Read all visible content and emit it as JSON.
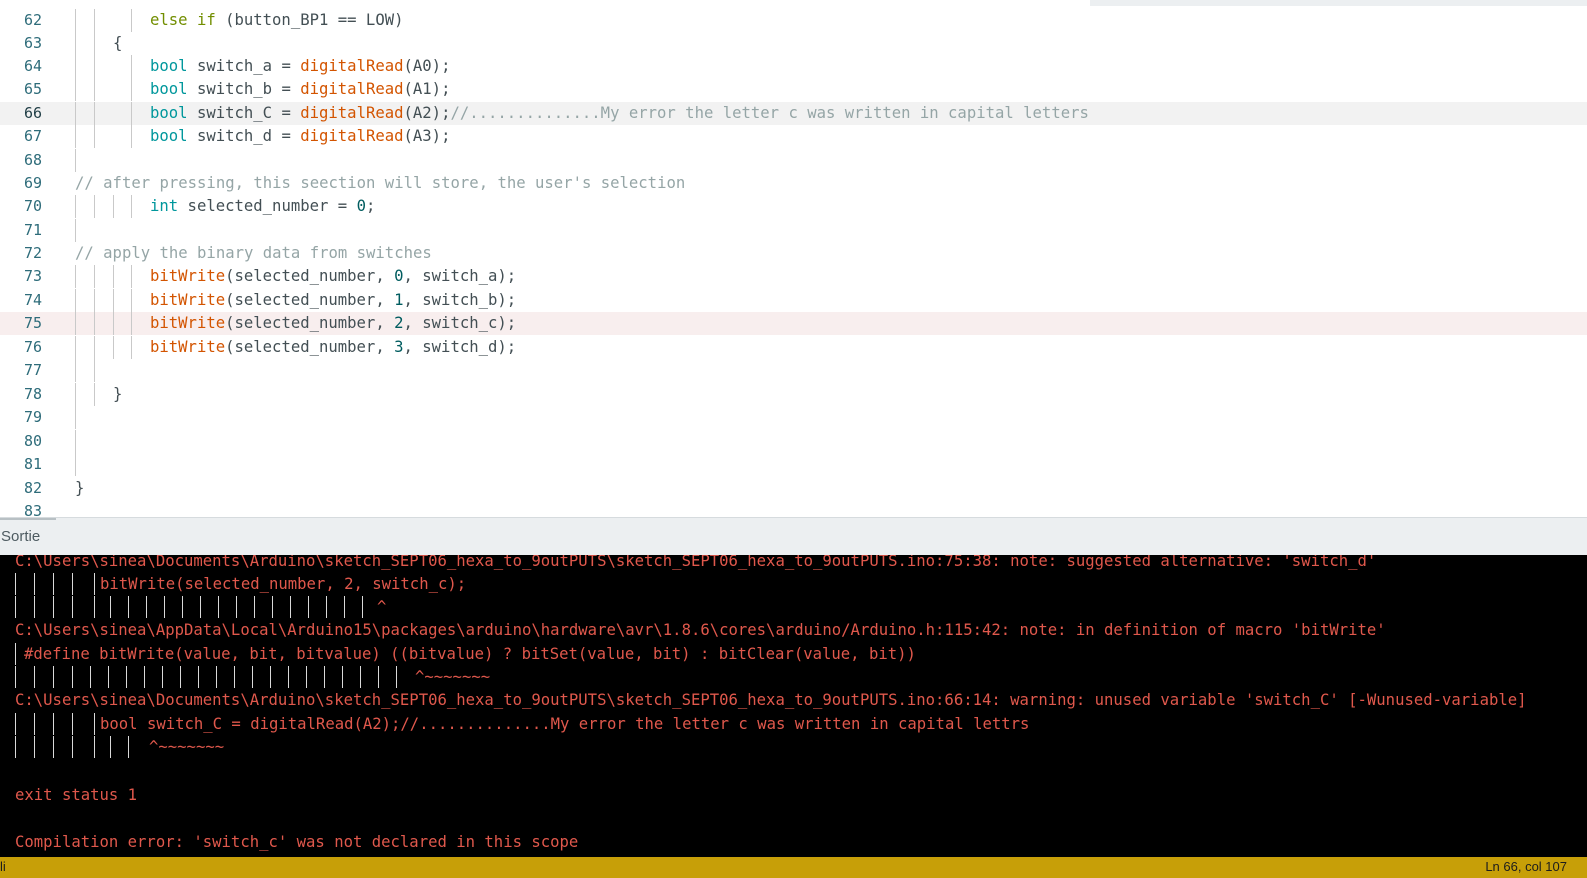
{
  "editor": {
    "lines": [
      {
        "number": "62",
        "tokens": [
          {
            "t": "else if",
            "c": "keyword"
          },
          {
            "t": " (button_BP1 == LOW)",
            "c": "plain"
          }
        ]
      },
      {
        "number": "63",
        "tokens": [
          {
            "t": "{",
            "c": "plain"
          }
        ]
      },
      {
        "number": "64",
        "tokens": [
          {
            "t": "bool",
            "c": "type"
          },
          {
            "t": " switch_a = ",
            "c": "plain"
          },
          {
            "t": "digitalRead",
            "c": "func"
          },
          {
            "t": "(A0);",
            "c": "plain"
          }
        ]
      },
      {
        "number": "65",
        "tokens": [
          {
            "t": "bool",
            "c": "type"
          },
          {
            "t": " switch_b = ",
            "c": "plain"
          },
          {
            "t": "digitalRead",
            "c": "func"
          },
          {
            "t": "(A1);",
            "c": "plain"
          }
        ]
      },
      {
        "number": "66",
        "tokens": [
          {
            "t": "bool",
            "c": "type"
          },
          {
            "t": " switch_C = ",
            "c": "plain"
          },
          {
            "t": "digitalRead",
            "c": "func"
          },
          {
            "t": "(A2);",
            "c": "plain"
          },
          {
            "t": "//..............My error the letter c was written in capital letters",
            "c": "comment"
          }
        ]
      },
      {
        "number": "67",
        "tokens": [
          {
            "t": "bool",
            "c": "type"
          },
          {
            "t": " switch_d = ",
            "c": "plain"
          },
          {
            "t": "digitalRead",
            "c": "func"
          },
          {
            "t": "(A3);",
            "c": "plain"
          }
        ]
      },
      {
        "number": "68",
        "tokens": []
      },
      {
        "number": "69",
        "tokens": [
          {
            "t": "// after pressing, this seection will store, the user's selection",
            "c": "comment"
          }
        ]
      },
      {
        "number": "70",
        "tokens": [
          {
            "t": "int",
            "c": "type"
          },
          {
            "t": " selected_number = ",
            "c": "plain"
          },
          {
            "t": "0",
            "c": "number"
          },
          {
            "t": ";",
            "c": "plain"
          }
        ]
      },
      {
        "number": "71",
        "tokens": []
      },
      {
        "number": "72",
        "tokens": [
          {
            "t": "// apply the binary data from switches",
            "c": "comment"
          }
        ]
      },
      {
        "number": "73",
        "tokens": [
          {
            "t": "bitWrite",
            "c": "func"
          },
          {
            "t": "(selected_number, ",
            "c": "plain"
          },
          {
            "t": "0",
            "c": "number"
          },
          {
            "t": ", switch_a);",
            "c": "plain"
          }
        ]
      },
      {
        "number": "74",
        "tokens": [
          {
            "t": "bitWrite",
            "c": "func"
          },
          {
            "t": "(selected_number, ",
            "c": "plain"
          },
          {
            "t": "1",
            "c": "number"
          },
          {
            "t": ", switch_b);",
            "c": "plain"
          }
        ]
      },
      {
        "number": "75",
        "tokens": [
          {
            "t": "bitWrite",
            "c": "func"
          },
          {
            "t": "(selected_number, ",
            "c": "plain"
          },
          {
            "t": "2",
            "c": "number"
          },
          {
            "t": ", switch_c);",
            "c": "plain"
          }
        ]
      },
      {
        "number": "76",
        "tokens": [
          {
            "t": "bitWrite",
            "c": "func"
          },
          {
            "t": "(selected_number, ",
            "c": "plain"
          },
          {
            "t": "3",
            "c": "number"
          },
          {
            "t": ", switch_d);",
            "c": "plain"
          }
        ]
      },
      {
        "number": "77",
        "tokens": []
      },
      {
        "number": "78",
        "tokens": [
          {
            "t": "}",
            "c": "plain"
          }
        ]
      },
      {
        "number": "79",
        "tokens": []
      },
      {
        "number": "80",
        "tokens": []
      },
      {
        "number": "81",
        "tokens": []
      },
      {
        "number": "82",
        "tokens": [
          {
            "t": "}",
            "c": "plain"
          }
        ]
      },
      {
        "number": "83",
        "tokens": []
      }
    ],
    "current_line": "66",
    "error_line": "75"
  },
  "output": {
    "title": "Sortie",
    "lines": [
      "C:\\Users\\sinea\\Documents\\Arduino\\sketch_SEPT06_hexa_to_9outPUTS\\sketch_SEPT06_hexa_to_9outPUTS.ino:75:38: note: suggested alternative: 'switch_d'",
      "bitWrite(selected_number, 2, switch_c);",
      "^",
      "C:\\Users\\sinea\\AppData\\Local\\Arduino15\\packages\\arduino\\hardware\\avr\\1.8.6\\cores\\arduino/Arduino.h:115:42: note: in definition of macro 'bitWrite'",
      "#define bitWrite(value, bit, bitvalue) ((bitvalue) ? bitSet(value, bit) : bitClear(value, bit))",
      "^~~~~~~~",
      "C:\\Users\\sinea\\Documents\\Arduino\\sketch_SEPT06_hexa_to_9outPUTS\\sketch_SEPT06_hexa_to_9outPUTS.ino:66:14: warning: unused variable 'switch_C' [-Wunused-variable]",
      "bool switch_C = digitalRead(A2);//..............My error the letter c was written in capital lettrs",
      "^~~~~~~~",
      "",
      "exit status 1",
      "",
      "Compilation error: 'switch_c' was not declared in this scope"
    ]
  },
  "status_bar": {
    "left": "li",
    "right": "Ln 66, col 107"
  },
  "colors": {
    "console_text": "#e0584c",
    "status_bar": "#c79f08",
    "keyword": "#728e00",
    "type": "#00979c",
    "function": "#d35400",
    "comment": "#95a5a6"
  }
}
